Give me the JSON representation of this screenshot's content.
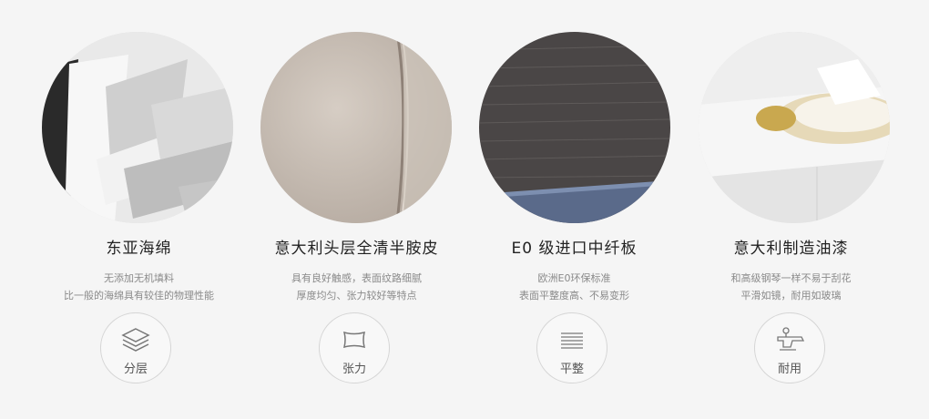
{
  "features": [
    {
      "title": "东亚海绵",
      "desc": [
        "无添加无机填料",
        "比一般的海绵具有较佳的物理性能"
      ],
      "badge_label": "分层",
      "icon": "layers-icon"
    },
    {
      "title": "意大利头层全清半胺皮",
      "desc": [
        "具有良好触感，表面纹路细腻",
        "厚度均匀、张力较好等特点"
      ],
      "badge_label": "张力",
      "icon": "leather-icon"
    },
    {
      "title": "E0 级进口中纤板",
      "desc": [
        "欧洲E0环保标准",
        "表面平整度高、不易变形"
      ],
      "badge_label": "平整",
      "icon": "flat-lines-icon"
    },
    {
      "title": "意大利制造油漆",
      "desc": [
        "和高级钢琴一样不易于刮花",
        "平滑如镜，耐用如玻璃"
      ],
      "badge_label": "耐用",
      "icon": "spray-gun-icon"
    }
  ],
  "colors": {
    "background": "#f5f5f5",
    "title": "#222222",
    "desc": "#8a8a8a",
    "badge_border": "#d5d5d5"
  }
}
